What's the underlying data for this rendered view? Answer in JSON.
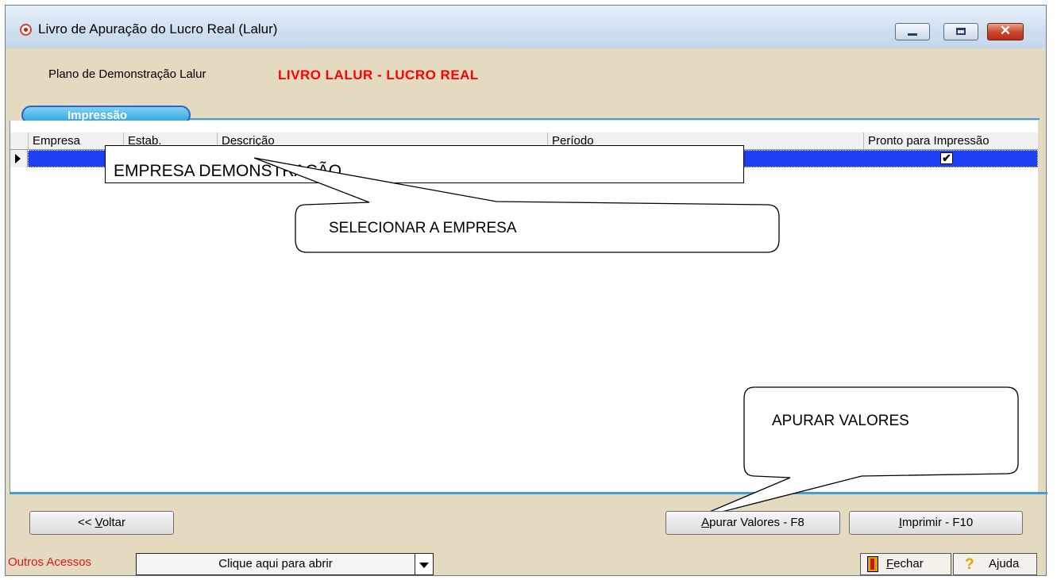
{
  "window": {
    "title": "Livro de Apuração do Lucro Real (Lalur)",
    "controls": {
      "close_glyph": "✕"
    }
  },
  "plan": {
    "label": "Plano de Demonstração Lalur",
    "value": "LIVRO LALUR - LUCRO REAL"
  },
  "tabs": [
    {
      "label": "Impressão"
    }
  ],
  "grid": {
    "columns": [
      "Empresa",
      "Estab.",
      "Descrição",
      "Período",
      "Pronto para Impressão"
    ],
    "rows": [
      {
        "selected": true,
        "pronto_para_impressao": "✔"
      }
    ]
  },
  "callouts": {
    "empresa_box": "EMPRESA DEMONSTRAÇÃO",
    "selecionar": "SELECIONAR A EMPRESA",
    "apurar": "APURAR VALORES"
  },
  "buttons": {
    "back": {
      "prefix": "<< ",
      "mnemonic": "V",
      "rest": "oltar"
    },
    "apurar": {
      "mnemonic": "A",
      "rest": "purar Valores - F8"
    },
    "print": {
      "mnemonic": "I",
      "rest": "mprimir - F10"
    }
  },
  "footer": {
    "outros_label": "Outros Acessos",
    "combo_value": "Clique aqui para abrir",
    "close": {
      "mnemonic": "F",
      "rest": "echar"
    },
    "help_label": "Ajuda",
    "help_glyph": "?"
  }
}
